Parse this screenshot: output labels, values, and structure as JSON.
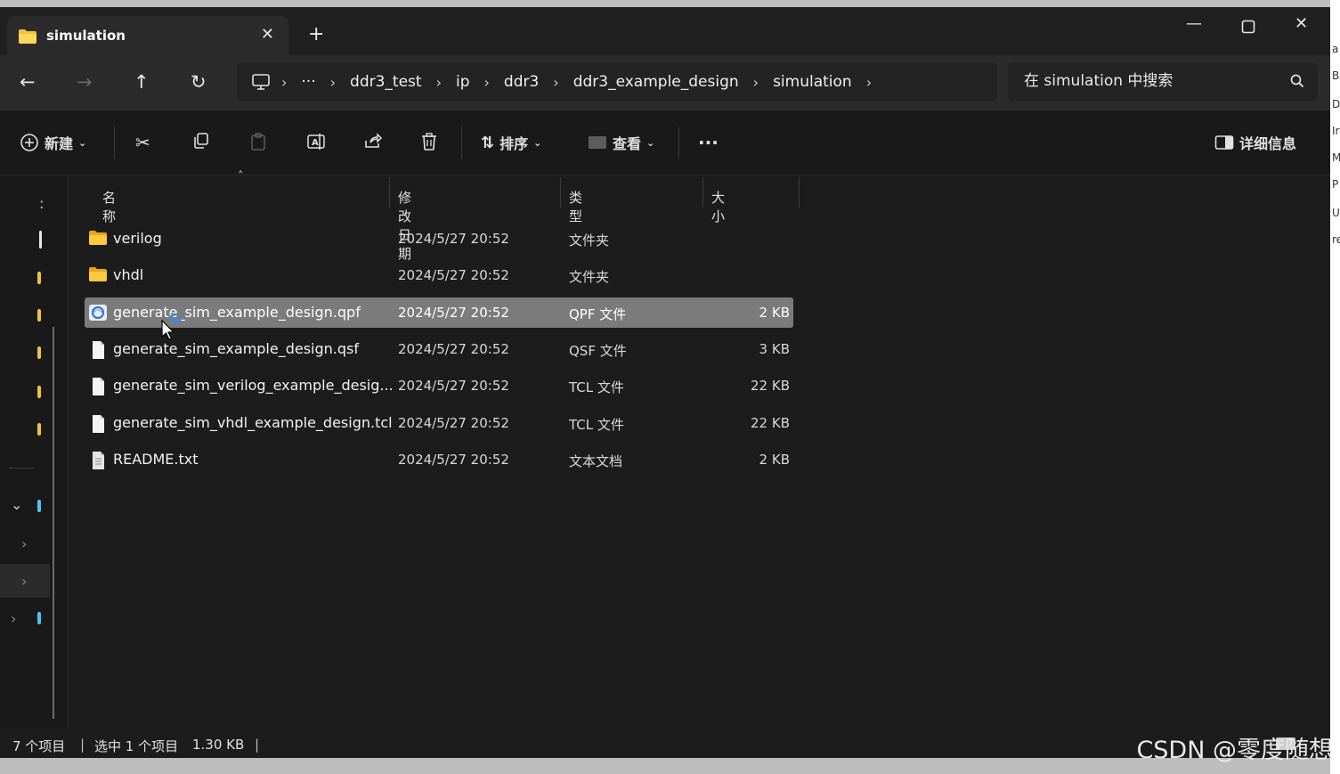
{
  "tab": {
    "title": "simulation"
  },
  "breadcrumb": [
    "ddr3_test",
    "ip",
    "ddr3",
    "ddr3_example_design",
    "simulation"
  ],
  "search": {
    "placeholder": "在 simulation 中搜索"
  },
  "toolbar": {
    "new_label": "新建",
    "sort_label": "排序",
    "view_label": "查看",
    "details_label": "详细信息"
  },
  "columns": {
    "name": "名称",
    "modified": "修改日期",
    "type": "类型",
    "size": "大小"
  },
  "files": [
    {
      "name": "verilog",
      "modified": "2024/5/27 20:52",
      "type": "文件夹",
      "size": "",
      "icon": "folder-icon"
    },
    {
      "name": "vhdl",
      "modified": "2024/5/27 20:52",
      "type": "文件夹",
      "size": "",
      "icon": "folder-icon"
    },
    {
      "name": "generate_sim_example_design.qpf",
      "modified": "2024/5/27 20:52",
      "type": "QPF 文件",
      "size": "2 KB",
      "icon": "qpf-file-icon",
      "selected": true
    },
    {
      "name": "generate_sim_example_design.qsf",
      "modified": "2024/5/27 20:52",
      "type": "QSF 文件",
      "size": "3 KB",
      "icon": "file-icon"
    },
    {
      "name": "generate_sim_verilog_example_desig...",
      "modified": "2024/5/27 20:52",
      "type": "TCL 文件",
      "size": "22 KB",
      "icon": "file-icon"
    },
    {
      "name": "generate_sim_vhdl_example_design.tcl",
      "modified": "2024/5/27 20:52",
      "type": "TCL 文件",
      "size": "22 KB",
      "icon": "file-icon"
    },
    {
      "name": "README.txt",
      "modified": "2024/5/27 20:52",
      "type": "文本文档",
      "size": "2 KB",
      "icon": "text-file-icon"
    }
  ],
  "status": {
    "item_count": "7 个项目",
    "selected": "选中 1 个项目",
    "selected_size": "1.30 KB"
  },
  "watermark": "CSDN @零度随想",
  "right_strip": [
    "a",
    "B",
    "D",
    "Ir",
    "M",
    "P",
    "U",
    "re"
  ]
}
